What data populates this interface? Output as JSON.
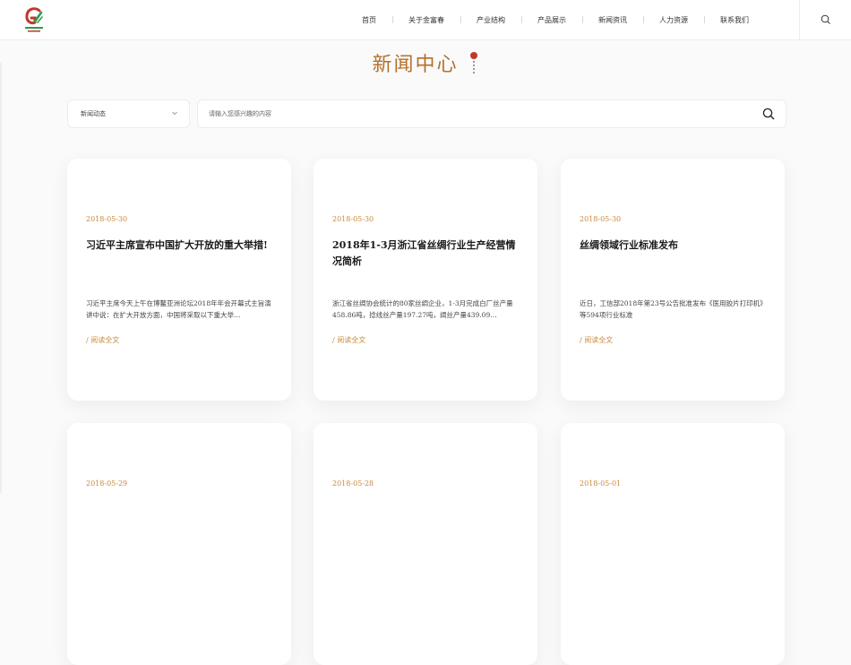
{
  "header": {
    "logo_alt": "Gold Rich Spring",
    "nav": [
      "首页",
      "关于金富春",
      "产业结构",
      "产品展示",
      "新闻资讯",
      "人力资源",
      "联系我们"
    ]
  },
  "page": {
    "title": "新闻中心"
  },
  "filter": {
    "category": "新闻动态",
    "search_placeholder": "请输入您感兴趣的内容"
  },
  "cards": [
    {
      "date": "2018-05-30",
      "title": "习近平主席宣布中国扩大开放的重大举措!",
      "excerpt": "习近平主席今天上午在博鳌亚洲论坛2018年年会开幕式主旨演讲中说：在扩大开放方面，中国将采取以下重大举…",
      "more": "/ 阅读全文"
    },
    {
      "date": "2018-05-30",
      "title": "2018年1-3月浙江省丝绸行业生产经营情况简析",
      "excerpt": "浙江省丝绸协会统计的80家丝绸企业，1-3月完成白厂丝产量458.86吨，捻线丝产量197.27吨，绸丝产量439.09…",
      "more": "/ 阅读全文"
    },
    {
      "date": "2018-05-30",
      "title": "丝绸领域行业标准发布",
      "excerpt": "近日，工信部2018年第23号公告批准发布《医用胶片打印机》等594项行业标准",
      "more": "/ 阅读全文"
    },
    {
      "date": "2018-05-29"
    },
    {
      "date": "2018-05-28"
    },
    {
      "date": "2018-05-01"
    }
  ],
  "colors": {
    "accent": "#c98a3a",
    "title": "#b5702a"
  }
}
